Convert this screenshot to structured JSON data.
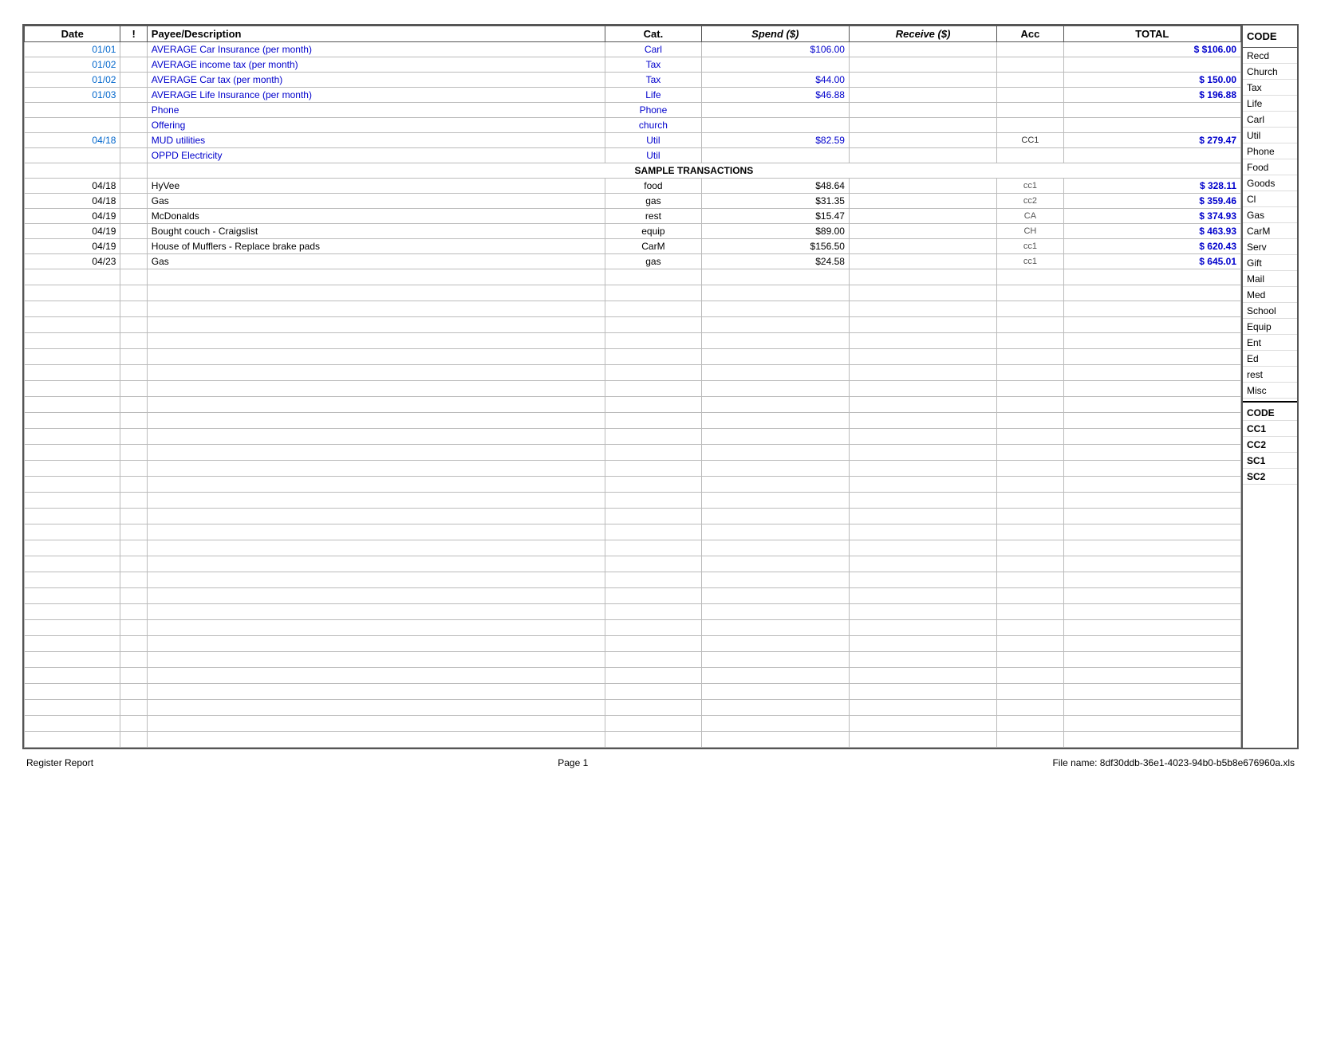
{
  "footer": {
    "left": "Register Report",
    "center": "Page 1",
    "right": "File name: 8df30ddb-36e1-4023-94b0-b5b8e676960a.xls"
  },
  "headers": {
    "date": "Date",
    "bang": "!",
    "payee": "Payee/Description",
    "cat": "Cat.",
    "spend": "Spend ($)",
    "receive": "Receive ($)",
    "acc": "Acc",
    "total": "TOTAL",
    "code": "CODE"
  },
  "rows": [
    {
      "date": "01/01",
      "bang": "",
      "payee": "AVERAGE Car Insurance (per month)",
      "cat": "Carl",
      "spend": "$106.00",
      "receive": "",
      "acc": "",
      "total": "$106.00",
      "style": "blue",
      "totalDollar": true
    },
    {
      "date": "01/02",
      "bang": "",
      "payee": "AVERAGE income tax (per month)",
      "cat": "Tax",
      "spend": "",
      "receive": "",
      "acc": "",
      "total": "",
      "style": "blue",
      "totalDollar": false
    },
    {
      "date": "01/02",
      "bang": "",
      "payee": "AVERAGE Car tax (per month)",
      "cat": "Tax",
      "spend": "$44.00",
      "receive": "",
      "acc": "",
      "total": "150.00",
      "style": "blue",
      "totalDollar": true
    },
    {
      "date": "01/03",
      "bang": "",
      "payee": "AVERAGE Life Insurance (per month)",
      "cat": "Life",
      "spend": "$46.88",
      "receive": "",
      "acc": "",
      "total": "196.88",
      "style": "blue",
      "totalDollar": true
    },
    {
      "date": "",
      "bang": "",
      "payee": "Phone",
      "cat": "Phone",
      "spend": "",
      "receive": "",
      "acc": "",
      "total": "",
      "style": "blue",
      "totalDollar": false
    },
    {
      "date": "",
      "bang": "",
      "payee": "Offering",
      "cat": "church",
      "spend": "",
      "receive": "",
      "acc": "",
      "total": "",
      "style": "blue",
      "totalDollar": false
    },
    {
      "date": "04/18",
      "bang": "",
      "payee": "MUD utilities",
      "cat": "Util",
      "spend": "$82.59",
      "receive": "",
      "acc": "CC1",
      "total": "279.47",
      "style": "blue",
      "totalDollar": true
    },
    {
      "date": "",
      "bang": "",
      "payee": "OPPD Electricity",
      "cat": "Util",
      "spend": "",
      "receive": "",
      "acc": "",
      "total": "",
      "style": "blue",
      "totalDollar": false
    },
    {
      "date": "",
      "bang": "",
      "payee": "SAMPLE TRANSACTIONS",
      "cat": "",
      "spend": "",
      "receive": "",
      "acc": "",
      "total": "",
      "style": "sample",
      "totalDollar": false
    },
    {
      "date": "04/18",
      "bang": "",
      "payee": "HyVee",
      "cat": "food",
      "spend": "$48.64",
      "receive": "",
      "acc": "cc1",
      "total": "328.11",
      "style": "plain",
      "totalDollar": true
    },
    {
      "date": "04/18",
      "bang": "",
      "payee": "Gas",
      "cat": "gas",
      "spend": "$31.35",
      "receive": "",
      "acc": "cc2",
      "total": "359.46",
      "style": "plain",
      "totalDollar": true
    },
    {
      "date": "04/19",
      "bang": "",
      "payee": "McDonalds",
      "cat": "rest",
      "spend": "$15.47",
      "receive": "",
      "acc": "CA",
      "total": "374.93",
      "style": "plain",
      "totalDollar": true
    },
    {
      "date": "04/19",
      "bang": "",
      "payee": "Bought couch - Craigslist",
      "cat": "equip",
      "spend": "$89.00",
      "receive": "",
      "acc": "CH",
      "total": "463.93",
      "style": "plain",
      "totalDollar": true
    },
    {
      "date": "04/19",
      "bang": "",
      "payee": "House of Mufflers - Replace brake pads",
      "cat": "CarM",
      "spend": "$156.50",
      "receive": "",
      "acc": "cc1",
      "total": "620.43",
      "style": "plain",
      "totalDollar": true
    },
    {
      "date": "04/23",
      "bang": "",
      "payee": "Gas",
      "cat": "gas",
      "spend": "$24.58",
      "receive": "",
      "acc": "cc1",
      "total": "645.01",
      "style": "plain",
      "totalDollar": true
    }
  ],
  "emptyRows": 30,
  "codeItems": [
    {
      "label": "Recd",
      "style": "normal"
    },
    {
      "label": "Church",
      "style": "normal"
    },
    {
      "label": "Tax",
      "style": "normal"
    },
    {
      "label": "Life",
      "style": "normal"
    },
    {
      "label": "Carl",
      "style": "normal"
    },
    {
      "label": "Util",
      "style": "normal"
    },
    {
      "label": "Phone",
      "style": "normal"
    },
    {
      "label": "Food",
      "style": "normal"
    },
    {
      "label": "Goods",
      "style": "normal"
    },
    {
      "label": "Cl",
      "style": "normal"
    },
    {
      "label": "Gas",
      "style": "normal"
    },
    {
      "label": "CarM",
      "style": "normal"
    },
    {
      "label": "Serv",
      "style": "normal"
    },
    {
      "label": "Gift",
      "style": "normal"
    },
    {
      "label": "Mail",
      "style": "normal"
    },
    {
      "label": "Med",
      "style": "normal"
    },
    {
      "label": "School",
      "style": "normal"
    },
    {
      "label": "Equip",
      "style": "normal"
    },
    {
      "label": "Ent",
      "style": "normal"
    },
    {
      "label": "Ed",
      "style": "normal"
    },
    {
      "label": "rest",
      "style": "normal"
    },
    {
      "label": "Misc",
      "style": "normal"
    }
  ],
  "codeFooterItems": [
    {
      "label": "CODE",
      "bold": true
    },
    {
      "label": "CC1",
      "bold": true
    },
    {
      "label": "CC2",
      "bold": true
    },
    {
      "label": "SC1",
      "bold": true
    },
    {
      "label": "SC2",
      "bold": true
    }
  ]
}
